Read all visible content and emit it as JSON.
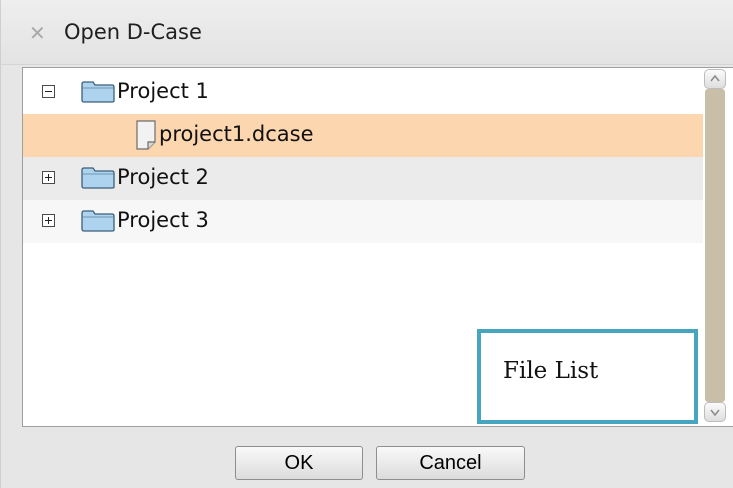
{
  "window": {
    "title": "Open D-Case",
    "close_icon": "close-icon"
  },
  "tree": {
    "items": [
      {
        "label": "Project 1",
        "kind": "folder",
        "expanded": true,
        "toggle": "minus"
      },
      {
        "label": "project1.dcase",
        "kind": "file",
        "selected": true
      },
      {
        "label": "Project 2",
        "kind": "folder",
        "expanded": false,
        "toggle": "plus"
      },
      {
        "label": "Project 3",
        "kind": "folder",
        "expanded": false,
        "toggle": "plus"
      }
    ]
  },
  "annotation": {
    "label": "File List",
    "color": "#46a6bf"
  },
  "buttons": {
    "ok_label": "OK",
    "cancel_label": "Cancel"
  },
  "colors": {
    "selection": "#fbd6ae",
    "scroll_thumb": "#c9bea8",
    "folder": "#aed3ee"
  }
}
